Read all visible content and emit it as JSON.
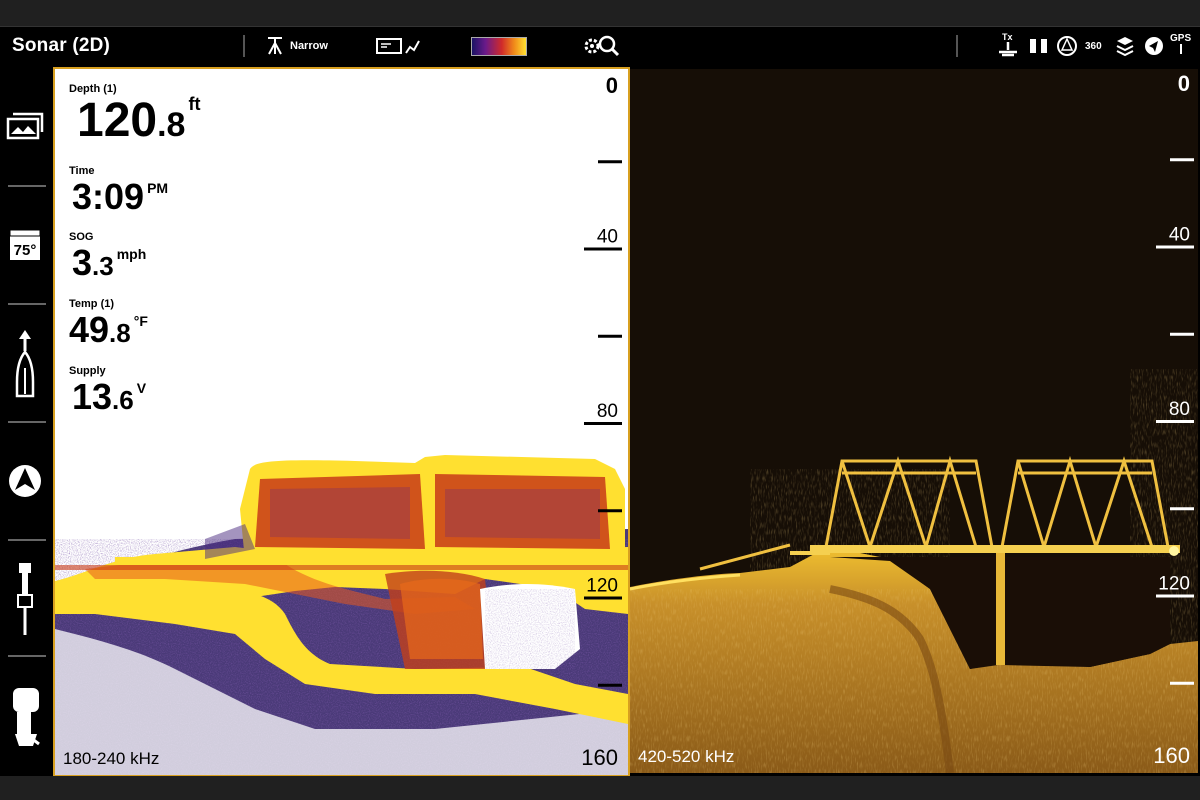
{
  "status_bar": {
    "title": "Sonar (2D)",
    "beam_label": "Narrow",
    "sonar_360_label": "360",
    "tx_label": "Tx",
    "gps_label": "GPS",
    "icons": [
      "beam-width-icon",
      "sensitivity-icon",
      "color-palette-icon",
      "settings-zoom-icon",
      "transmit-icon",
      "battery-icon",
      "compass-icon",
      "sonar-360-icon",
      "layers-icon",
      "navigation-icon",
      "gps-icon"
    ]
  },
  "sidebar": {
    "items": [
      {
        "name": "views-icon"
      },
      {
        "name": "temperature-icon",
        "label": "75°"
      },
      {
        "name": "boat-heading-icon"
      },
      {
        "name": "autopilot-icon"
      },
      {
        "name": "transducer-icon"
      },
      {
        "name": "motor-icon"
      }
    ]
  },
  "left_panel": {
    "frequency": "180-240 kHz",
    "depth_scale": [
      "0",
      "40",
      "80",
      "120",
      "160"
    ],
    "readouts": [
      {
        "label": "Depth (1)",
        "int": "120",
        "dec": ".8",
        "unit": "ft"
      },
      {
        "label": "Time",
        "int": "3:09",
        "dec": "",
        "unit": "PM"
      },
      {
        "label": "SOG",
        "int": "3",
        "dec": ".3",
        "unit": "mph"
      },
      {
        "label": "Temp (1)",
        "int": "49",
        "dec": ".8",
        "unit": "°F"
      },
      {
        "label": "Supply",
        "int": "13",
        "dec": ".6",
        "unit": "V"
      }
    ]
  },
  "right_panel": {
    "frequency": "420-520 kHz",
    "depth_scale": [
      "0",
      "40",
      "80",
      "120",
      "160"
    ]
  },
  "colors": {
    "frame": "#202020",
    "active_border": "#d8a020",
    "right_background": "#160e06",
    "sonar_yellow": "#ffe030"
  }
}
